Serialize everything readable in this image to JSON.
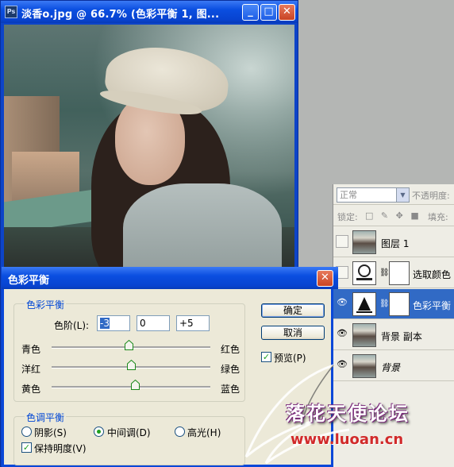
{
  "doc_window": {
    "app_icon": "Ps",
    "title": "淡香o.jpg @ 66.7% (色彩平衡 1, 图...",
    "buttons": {
      "minimize": "_",
      "maximize": "□",
      "close": "✕"
    }
  },
  "layers_panel": {
    "blend_mode": "正常",
    "opacity_label": "不透明度:",
    "lock_label": "锁定:",
    "lock_icons": "□ ✎ ✥ ■",
    "fill_label": "填充:",
    "layers": [
      {
        "name": "图层 1",
        "visible": false,
        "selected": false,
        "thumb": "photo",
        "has_mask": false
      },
      {
        "name": "选取颜色",
        "visible": false,
        "selected": false,
        "thumb": "adjustment",
        "has_mask": true
      },
      {
        "name": "色彩平衡",
        "visible": true,
        "selected": true,
        "thumb": "adjustment",
        "has_mask": true
      },
      {
        "name": "背景 副本",
        "visible": true,
        "selected": false,
        "thumb": "photo",
        "has_mask": false
      },
      {
        "name": "背景",
        "visible": true,
        "selected": false,
        "thumb": "photo",
        "has_mask": false
      }
    ]
  },
  "dialog": {
    "title": "色彩平衡",
    "close": "✕",
    "color_balance": {
      "legend": "色彩平衡",
      "levels_label": "色阶(L):",
      "levels": [
        "-3",
        "0",
        "+5"
      ],
      "sliders": [
        {
          "left": "青色",
          "right": "红色",
          "value": -3
        },
        {
          "left": "洋红",
          "right": "绿色",
          "value": 0
        },
        {
          "left": "黄色",
          "right": "蓝色",
          "value": 5
        }
      ]
    },
    "tone_balance": {
      "legend": "色调平衡",
      "options": [
        "阴影(S)",
        "中间调(D)",
        "高光(H)"
      ],
      "selected": "中间调(D)",
      "preserve_luminosity": "保持明度(V)",
      "preserve_checked": true
    },
    "buttons": {
      "ok": "确定",
      "cancel": "取消"
    },
    "preview": {
      "label": "预览(P)",
      "checked": true
    }
  },
  "watermark": {
    "title": "落花天使论坛",
    "url": "www.luoan.cn"
  }
}
